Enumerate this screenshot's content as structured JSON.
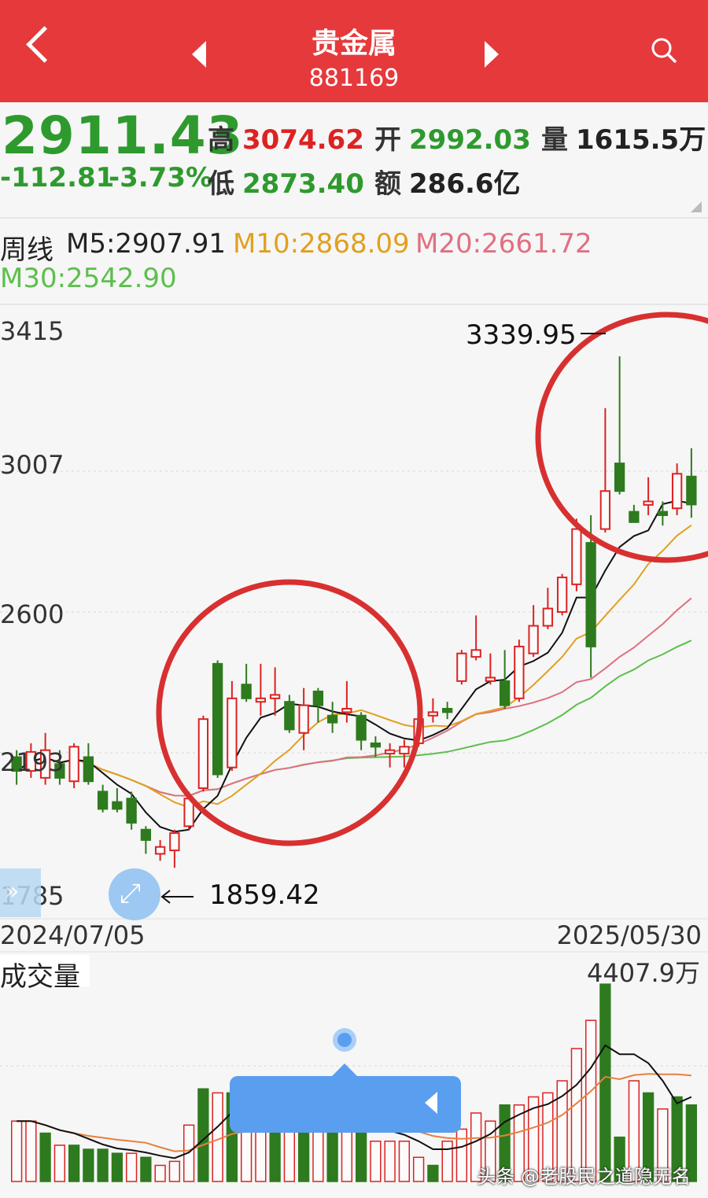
{
  "header": {
    "title": "贵金属",
    "code": "881169"
  },
  "quote": {
    "price": "2911.43",
    "change": "-112.81",
    "change_pct": "-3.73%",
    "high_label": "高",
    "high": "3074.62",
    "low_label": "低",
    "low": "2873.40",
    "open_label": "开",
    "open": "2992.03",
    "amount_label": "额",
    "amount": "286.6亿",
    "volume_label": "量",
    "volume": "1615.5万"
  },
  "ma": {
    "period": "周线",
    "m5": "M5:2907.91",
    "m10": "M10:2868.09",
    "m20": "M20:2661.72",
    "m30": "M30:2542.90"
  },
  "colors": {
    "up": "#d22",
    "down": "#2e7a1e",
    "m5": "#111111",
    "m10": "#e0a020",
    "m20": "#e07080",
    "m30": "#5cbf4c",
    "circle": "#d83030"
  },
  "annotations": {
    "high": "3339.95",
    "low": "1859.42"
  },
  "axis": {
    "start_date": "2024/07/05",
    "end_date": "2025/05/30",
    "volume_label": "成交量",
    "volume_max": "4407.9万",
    "watermark": "头条 @老股民之道隐无名"
  },
  "chart_data": {
    "type": "candlestick",
    "y_ticks": [
      "3415",
      "3007",
      "2600",
      "2193",
      "1785"
    ],
    "ylim": [
      1785,
      3415
    ],
    "candles": [
      {
        "o": 2180,
        "c": 2140,
        "h": 2200,
        "l": 2100,
        "up": false
      },
      {
        "o": 2140,
        "c": 2195,
        "h": 2220,
        "l": 2120,
        "up": true
      },
      {
        "o": 2120,
        "c": 2200,
        "h": 2250,
        "l": 2100,
        "up": true
      },
      {
        "o": 2160,
        "c": 2120,
        "h": 2200,
        "l": 2100,
        "up": false
      },
      {
        "o": 2110,
        "c": 2210,
        "h": 2220,
        "l": 2090,
        "up": true
      },
      {
        "o": 2180,
        "c": 2110,
        "h": 2220,
        "l": 2100,
        "up": false
      },
      {
        "o": 2080,
        "c": 2030,
        "h": 2100,
        "l": 2020,
        "up": false
      },
      {
        "o": 2050,
        "c": 2030,
        "h": 2090,
        "l": 2020,
        "up": false
      },
      {
        "o": 2060,
        "c": 1990,
        "h": 2080,
        "l": 1970,
        "up": false
      },
      {
        "o": 1970,
        "c": 1940,
        "h": 1980,
        "l": 1900,
        "up": false
      },
      {
        "o": 1920,
        "c": 1900,
        "h": 1940,
        "l": 1880,
        "up": true
      },
      {
        "o": 1910,
        "c": 1960,
        "h": 1970,
        "l": 1860,
        "up": true
      },
      {
        "o": 1980,
        "c": 2060,
        "h": 2080,
        "l": 1970,
        "up": true
      },
      {
        "o": 2090,
        "c": 2290,
        "h": 2300,
        "l": 2080,
        "up": true
      },
      {
        "o": 2450,
        "c": 2130,
        "h": 2460,
        "l": 2120,
        "up": false
      },
      {
        "o": 2150,
        "c": 2350,
        "h": 2400,
        "l": 2140,
        "up": true
      },
      {
        "o": 2390,
        "c": 2350,
        "h": 2450,
        "l": 2340,
        "up": false
      },
      {
        "o": 2340,
        "c": 2350,
        "h": 2450,
        "l": 2300,
        "up": true
      },
      {
        "o": 2350,
        "c": 2360,
        "h": 2440,
        "l": 2300,
        "up": true
      },
      {
        "o": 2340,
        "c": 2260,
        "h": 2360,
        "l": 2250,
        "up": false
      },
      {
        "o": 2250,
        "c": 2330,
        "h": 2380,
        "l": 2200,
        "up": true
      },
      {
        "o": 2370,
        "c": 2330,
        "h": 2380,
        "l": 2280,
        "up": false
      },
      {
        "o": 2300,
        "c": 2280,
        "h": 2340,
        "l": 2250,
        "up": false
      },
      {
        "o": 2310,
        "c": 2320,
        "h": 2400,
        "l": 2280,
        "up": true
      },
      {
        "o": 2300,
        "c": 2230,
        "h": 2310,
        "l": 2200,
        "up": false
      },
      {
        "o": 2220,
        "c": 2210,
        "h": 2240,
        "l": 2180,
        "up": false
      },
      {
        "o": 2190,
        "c": 2200,
        "h": 2220,
        "l": 2150,
        "up": true
      },
      {
        "o": 2190,
        "c": 2210,
        "h": 2230,
        "l": 2150,
        "up": true
      },
      {
        "o": 2220,
        "c": 2290,
        "h": 2300,
        "l": 2210,
        "up": true
      },
      {
        "o": 2300,
        "c": 2310,
        "h": 2350,
        "l": 2280,
        "up": true
      },
      {
        "o": 2320,
        "c": 2310,
        "h": 2340,
        "l": 2290,
        "up": false
      },
      {
        "o": 2400,
        "c": 2480,
        "h": 2490,
        "l": 2390,
        "up": true
      },
      {
        "o": 2470,
        "c": 2490,
        "h": 2590,
        "l": 2460,
        "up": true
      },
      {
        "o": 2400,
        "c": 2410,
        "h": 2480,
        "l": 2390,
        "up": true
      },
      {
        "o": 2400,
        "c": 2330,
        "h": 2490,
        "l": 2320,
        "up": false
      },
      {
        "o": 2350,
        "c": 2500,
        "h": 2520,
        "l": 2340,
        "up": true
      },
      {
        "o": 2480,
        "c": 2560,
        "h": 2620,
        "l": 2470,
        "up": true
      },
      {
        "o": 2560,
        "c": 2610,
        "h": 2670,
        "l": 2550,
        "up": true
      },
      {
        "o": 2600,
        "c": 2700,
        "h": 2710,
        "l": 2590,
        "up": true
      },
      {
        "o": 2680,
        "c": 2840,
        "h": 2870,
        "l": 2660,
        "up": true
      },
      {
        "o": 2800,
        "c": 2500,
        "h": 2880,
        "l": 2410,
        "up": false
      },
      {
        "o": 2840,
        "c": 2950,
        "h": 3190,
        "l": 2830,
        "up": true
      },
      {
        "o": 3030,
        "c": 2950,
        "h": 3340,
        "l": 2940,
        "up": false
      },
      {
        "o": 2890,
        "c": 2860,
        "h": 2910,
        "l": 2860,
        "up": false
      },
      {
        "o": 2910,
        "c": 2920,
        "h": 2990,
        "l": 2880,
        "up": true
      },
      {
        "o": 2890,
        "c": 2880,
        "h": 2920,
        "l": 2850,
        "up": false
      },
      {
        "o": 2900,
        "c": 3000,
        "h": 3030,
        "l": 2880,
        "up": true
      },
      {
        "o": 2992,
        "c": 2911,
        "h": 3074,
        "l": 2873,
        "up": false
      }
    ],
    "volumes": [
      {
        "v": 0.3,
        "up": true
      },
      {
        "v": 0.3,
        "up": true
      },
      {
        "v": 0.24,
        "up": false
      },
      {
        "v": 0.18,
        "up": true
      },
      {
        "v": 0.18,
        "up": false
      },
      {
        "v": 0.16,
        "up": false
      },
      {
        "v": 0.16,
        "up": false
      },
      {
        "v": 0.14,
        "up": false
      },
      {
        "v": 0.14,
        "up": true
      },
      {
        "v": 0.12,
        "up": false
      },
      {
        "v": 0.08,
        "up": true
      },
      {
        "v": 0.1,
        "up": true
      },
      {
        "v": 0.28,
        "up": true
      },
      {
        "v": 0.46,
        "up": false
      },
      {
        "v": 0.44,
        "up": true
      },
      {
        "v": 0.44,
        "up": false
      },
      {
        "v": 0.3,
        "up": true
      },
      {
        "v": 0.52,
        "up": true
      },
      {
        "v": 0.4,
        "up": false
      },
      {
        "v": 0.3,
        "up": true
      },
      {
        "v": 0.3,
        "up": false
      },
      {
        "v": 0.3,
        "up": true
      },
      {
        "v": 0.3,
        "up": false
      },
      {
        "v": 0.28,
        "up": true
      },
      {
        "v": 0.28,
        "up": false
      },
      {
        "v": 0.2,
        "up": true
      },
      {
        "v": 0.2,
        "up": true
      },
      {
        "v": 0.2,
        "up": true
      },
      {
        "v": 0.12,
        "up": true
      },
      {
        "v": 0.08,
        "up": false
      },
      {
        "v": 0.2,
        "up": true
      },
      {
        "v": 0.26,
        "up": true
      },
      {
        "v": 0.34,
        "up": true
      },
      {
        "v": 0.3,
        "up": true
      },
      {
        "v": 0.38,
        "up": false
      },
      {
        "v": 0.38,
        "up": true
      },
      {
        "v": 0.42,
        "up": true
      },
      {
        "v": 0.44,
        "up": true
      },
      {
        "v": 0.5,
        "up": true
      },
      {
        "v": 0.66,
        "up": true
      },
      {
        "v": 0.8,
        "up": true
      },
      {
        "v": 0.98,
        "up": false
      },
      {
        "v": 0.22,
        "up": false
      },
      {
        "v": 0.5,
        "up": true
      },
      {
        "v": 0.44,
        "up": false
      },
      {
        "v": 0.36,
        "up": true
      },
      {
        "v": 0.42,
        "up": false
      },
      {
        "v": 0.38,
        "up": false
      }
    ]
  }
}
